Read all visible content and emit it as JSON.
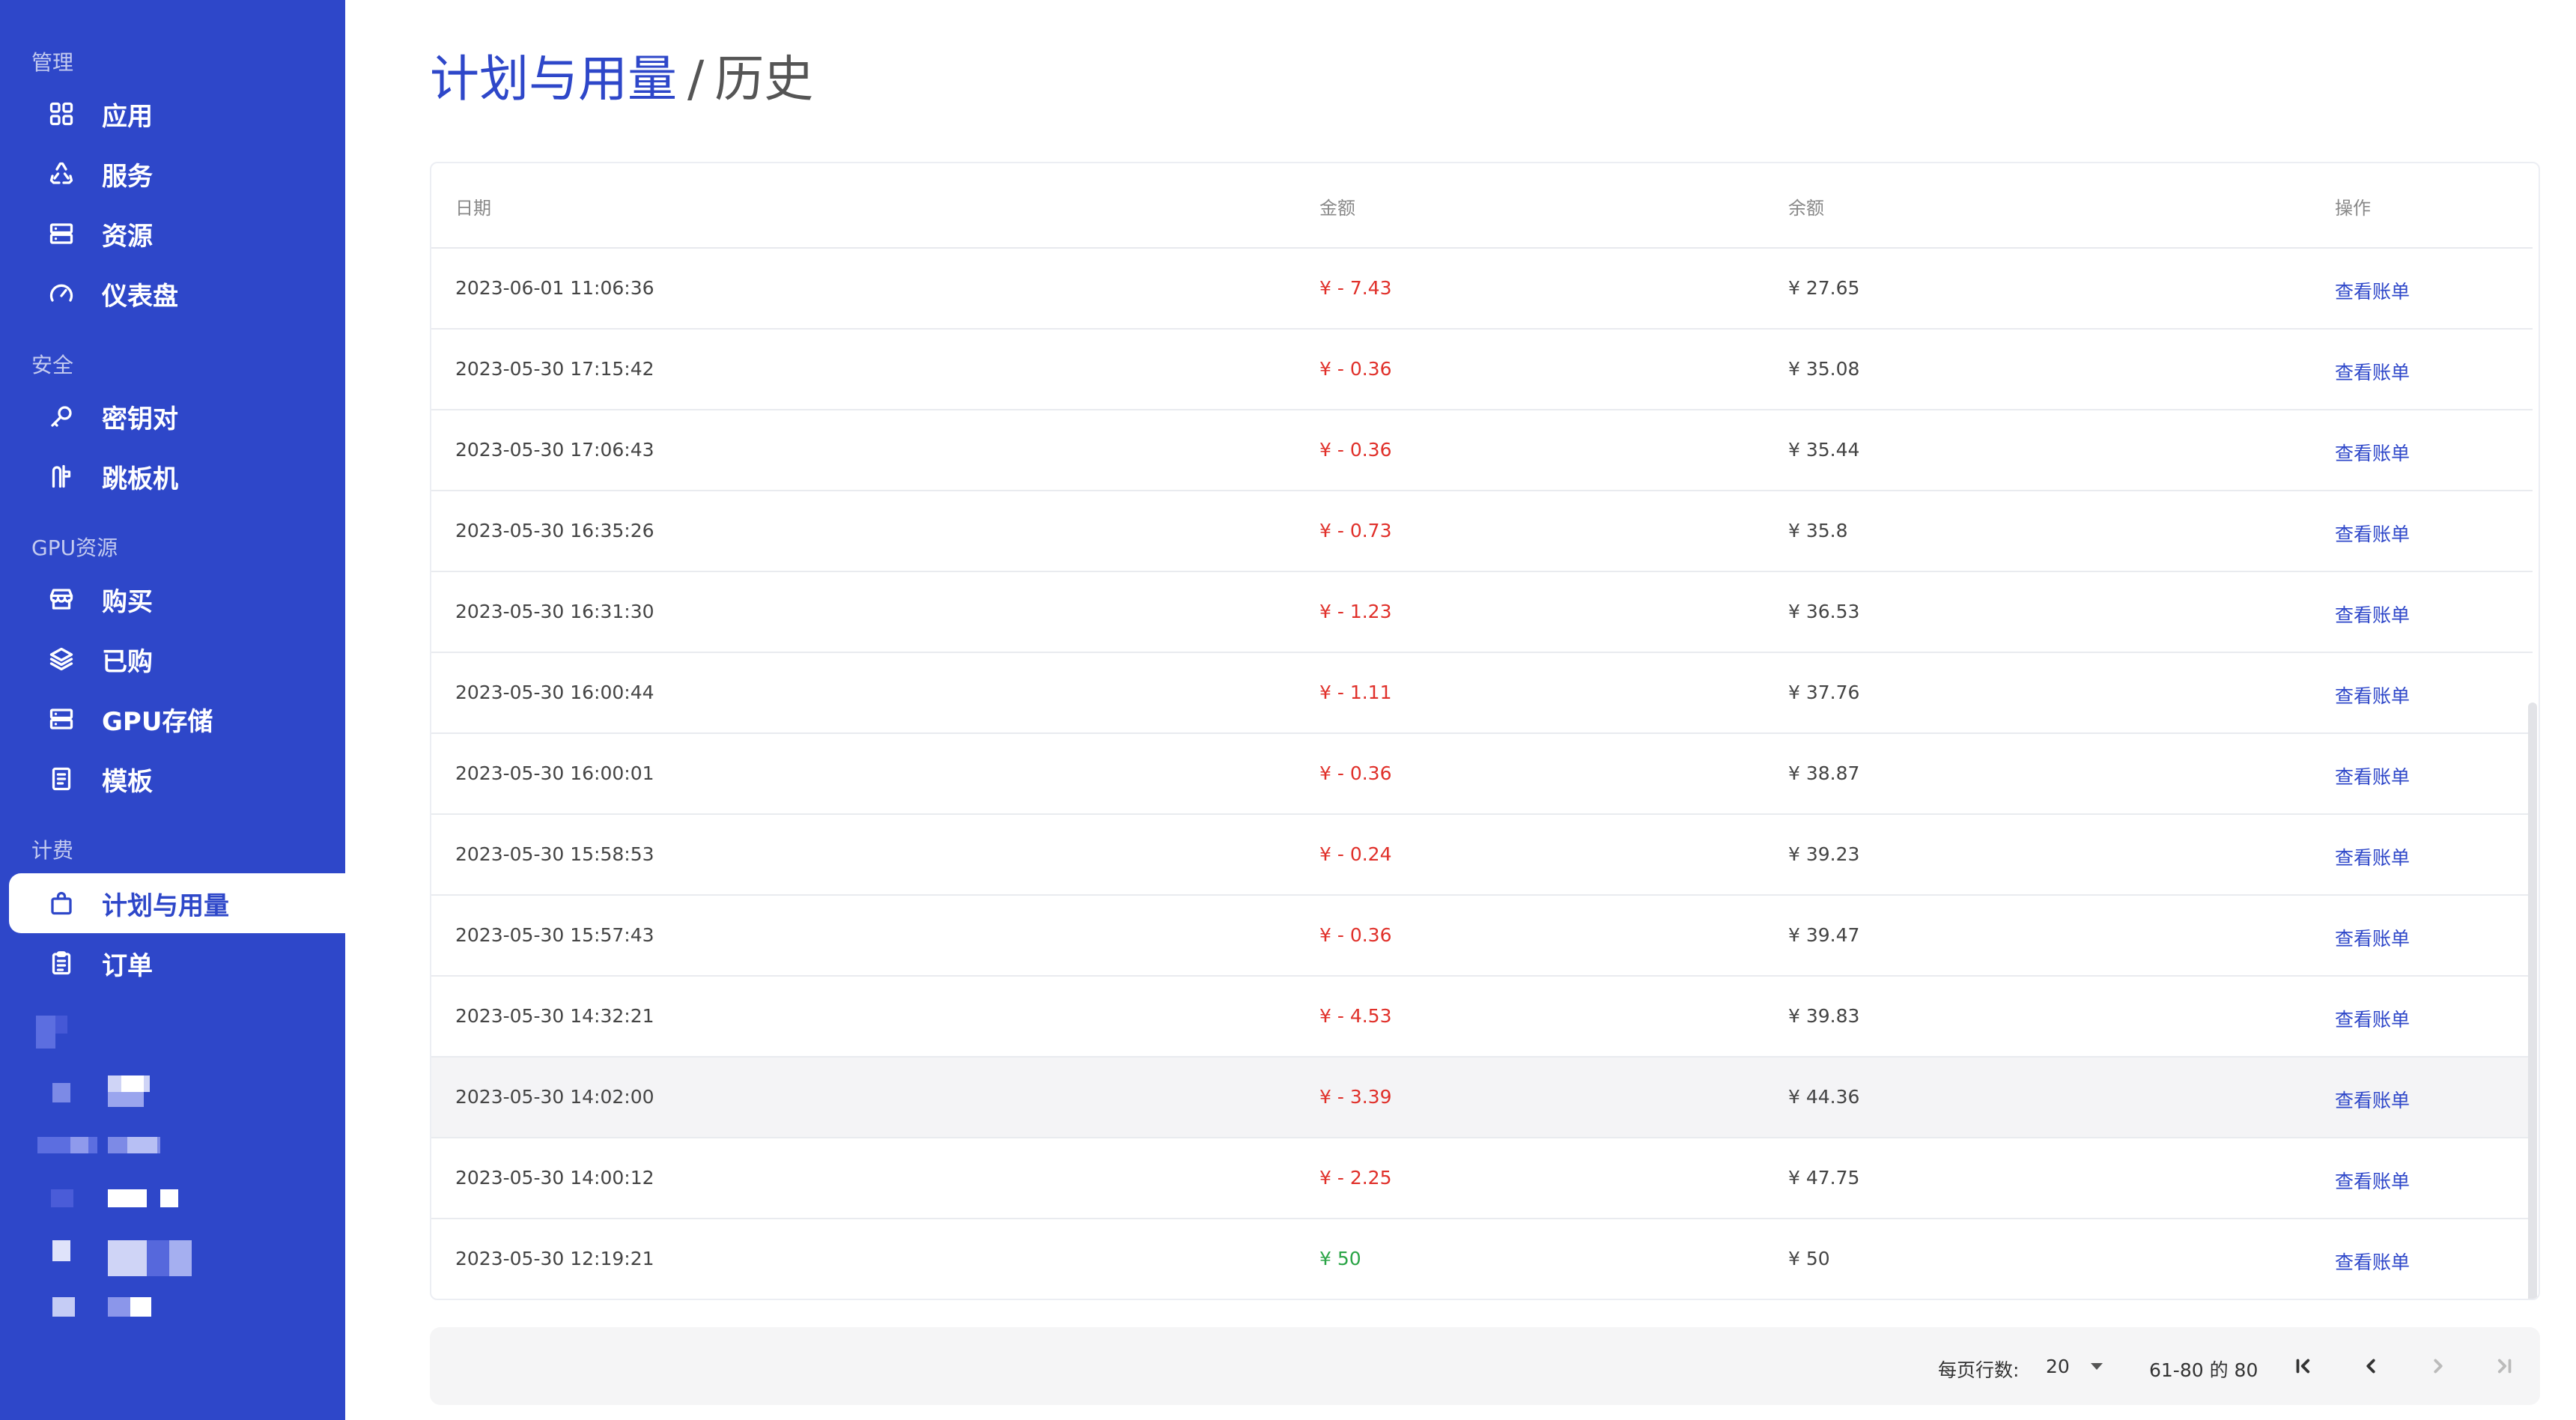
{
  "sidebar": {
    "sections": [
      {
        "title": "管理",
        "items": [
          {
            "label": "应用",
            "icon": "grid-icon"
          },
          {
            "label": "服务",
            "icon": "recycle-icon"
          },
          {
            "label": "资源",
            "icon": "server-icon"
          },
          {
            "label": "仪表盘",
            "icon": "gauge-icon"
          }
        ]
      },
      {
        "title": "安全",
        "items": [
          {
            "label": "密钥对",
            "icon": "key-icon"
          },
          {
            "label": "跳板机",
            "icon": "jump-icon"
          }
        ]
      },
      {
        "title": "GPU资源",
        "items": [
          {
            "label": "购买",
            "icon": "store-icon"
          },
          {
            "label": "已购",
            "icon": "layers-icon"
          },
          {
            "label": "GPU存储",
            "icon": "server-icon"
          },
          {
            "label": "模板",
            "icon": "document-icon"
          }
        ]
      },
      {
        "title": "计费",
        "items": [
          {
            "label": "计划与用量",
            "icon": "bag-icon",
            "active": true
          },
          {
            "label": "订单",
            "icon": "clipboard-icon"
          }
        ]
      }
    ]
  },
  "page": {
    "title_main": "计划与用量",
    "separator": "/",
    "title_sub": "历史"
  },
  "table": {
    "headers": {
      "date": "日期",
      "amount": "金额",
      "balance": "余额",
      "action": "操作"
    },
    "rows": [
      {
        "date": "2023-06-01 11:06:36",
        "amount": "¥ - 7.43",
        "type": "neg",
        "balance": "¥ 27.65",
        "action": "查看账单"
      },
      {
        "date": "2023-05-30 17:15:42",
        "amount": "¥ - 0.36",
        "type": "neg",
        "balance": "¥ 35.08",
        "action": "查看账单"
      },
      {
        "date": "2023-05-30 17:06:43",
        "amount": "¥ - 0.36",
        "type": "neg",
        "balance": "¥ 35.44",
        "action": "查看账单"
      },
      {
        "date": "2023-05-30 16:35:26",
        "amount": "¥ - 0.73",
        "type": "neg",
        "balance": "¥ 35.8",
        "action": "查看账单"
      },
      {
        "date": "2023-05-30 16:31:30",
        "amount": "¥ - 1.23",
        "type": "neg",
        "balance": "¥ 36.53",
        "action": "查看账单"
      },
      {
        "date": "2023-05-30 16:00:44",
        "amount": "¥ - 1.11",
        "type": "neg",
        "balance": "¥ 37.76",
        "action": "查看账单"
      },
      {
        "date": "2023-05-30 16:00:01",
        "amount": "¥ - 0.36",
        "type": "neg",
        "balance": "¥ 38.87",
        "action": "查看账单"
      },
      {
        "date": "2023-05-30 15:58:53",
        "amount": "¥ - 0.24",
        "type": "neg",
        "balance": "¥ 39.23",
        "action": "查看账单"
      },
      {
        "date": "2023-05-30 15:57:43",
        "amount": "¥ - 0.36",
        "type": "neg",
        "balance": "¥ 39.47",
        "action": "查看账单"
      },
      {
        "date": "2023-05-30 14:32:21",
        "amount": "¥ - 4.53",
        "type": "neg",
        "balance": "¥ 39.83",
        "action": "查看账单"
      },
      {
        "date": "2023-05-30 14:02:00",
        "amount": "¥ - 3.39",
        "type": "neg",
        "balance": "¥ 44.36",
        "action": "查看账单",
        "highlight": true
      },
      {
        "date": "2023-05-30 14:00:12",
        "amount": "¥ - 2.25",
        "type": "neg",
        "balance": "¥ 47.75",
        "action": "查看账单"
      },
      {
        "date": "2023-05-30 12:19:21",
        "amount": "¥ 50",
        "type": "pos",
        "balance": "¥ 50",
        "action": "查看账单"
      }
    ]
  },
  "pagination": {
    "rows_per_page_label": "每页行数:",
    "rows_per_page": "20",
    "range": "61-80 的 80"
  },
  "colors": {
    "brand": "#2e47c9",
    "negative": "#e0302a",
    "positive": "#2aa446"
  }
}
